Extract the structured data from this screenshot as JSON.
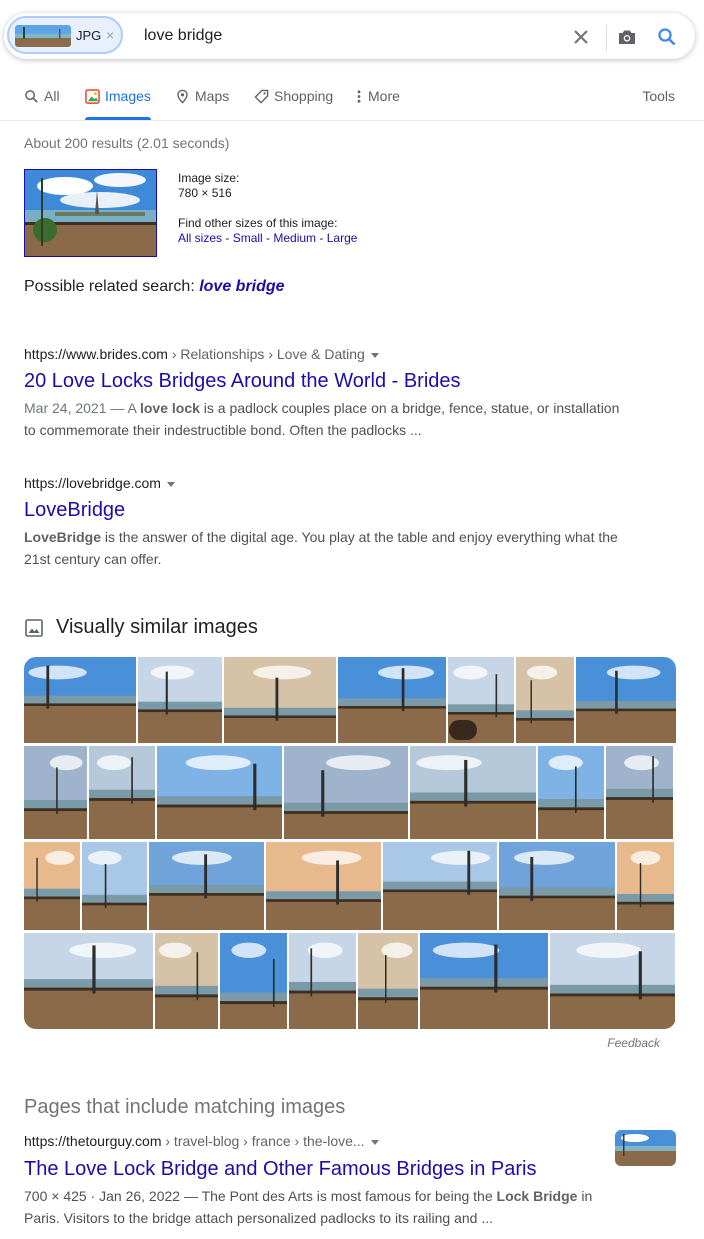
{
  "search": {
    "chip_label": "JPG",
    "chip_close": "×",
    "query": "love bridge"
  },
  "tabs": [
    {
      "label": "All",
      "icon": "search-icon"
    },
    {
      "label": "Images",
      "icon": "images-icon",
      "active": true
    },
    {
      "label": "Maps",
      "icon": "map-pin-icon"
    },
    {
      "label": "Shopping",
      "icon": "tag-icon"
    },
    {
      "label": "More",
      "icon": "more-vert-icon"
    }
  ],
  "tools_label": "Tools",
  "stats": "About 200 results (2.01 seconds)",
  "image_info": {
    "size_label": "Image size:",
    "size_value": "780 × 516",
    "find_label": "Find other sizes of this image:",
    "all_sizes": "All sizes",
    "small": "Small",
    "medium": "Medium",
    "large": "Large",
    "sep": " - "
  },
  "related": {
    "label": "Possible related search: ",
    "query": "love bridge"
  },
  "results": [
    {
      "domain": "https://www.brides.com",
      "path": " › Relationships › Love & Dating",
      "title": "20 Love Locks Bridges Around the World - Brides",
      "date": "Mar 24, 2021 — A ",
      "snippet_bold": "love lock",
      "snippet_rest": " is a padlock couples place on a bridge, fence, statue, or installation to commemorate their indestructible bond. Often the padlocks ..."
    },
    {
      "domain": "https://lovebridge.com",
      "path": "",
      "title": "LoveBridge",
      "snippet_bold": "LoveBridge",
      "snippet_rest": " is the answer of the digital age. You play at the table and enjoy everything what the 21st century can offer."
    }
  ],
  "visually_similar": {
    "heading": "Visually similar images",
    "feedback": "Feedback"
  },
  "pages": {
    "heading": "Pages that include matching images",
    "domain": "https://thetourguy.com",
    "path": " › travel-blog › france › the-love...",
    "title": "The Love Lock Bridge and Other Famous Bridges in Paris",
    "meta": "700 × 425 · Jan 26, 2022 — The Pont des Arts is most famous for being the ",
    "bold": "Lock Bridge",
    "rest": " in Paris. Visitors to the bridge attach personalized padlocks to its railing and ..."
  },
  "colors": {
    "accent": "#1a73e8",
    "link": "#1a0dab",
    "sky": "#4a90d9",
    "locks": "#8b6a4a"
  }
}
